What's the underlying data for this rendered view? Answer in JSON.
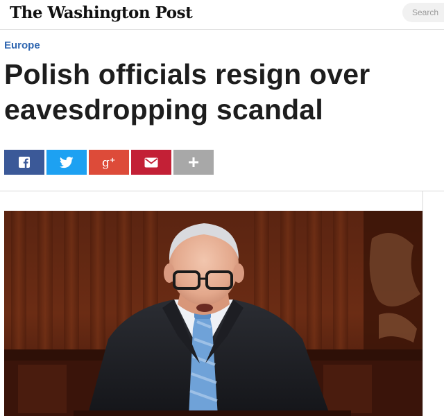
{
  "masthead": {
    "logo_text": "The Washington Post",
    "search_label": "Search"
  },
  "article": {
    "kicker": "Europe",
    "headline": "Polish officials resign over eavesdropping scandal"
  },
  "share": {
    "buttons": [
      {
        "name": "facebook",
        "icon": "facebook-icon",
        "color": "#3b5998"
      },
      {
        "name": "twitter",
        "icon": "twitter-icon",
        "color": "#1da1f2"
      },
      {
        "name": "google-plus",
        "icon": "google-plus-icon",
        "color": "#dd4b39"
      },
      {
        "name": "email",
        "icon": "email-icon",
        "color": "#c32036"
      },
      {
        "name": "more",
        "icon": "plus-icon",
        "color": "#a8a8a8"
      }
    ]
  },
  "colors": {
    "kicker": "#2f66b0",
    "headline": "#1d1d1d",
    "search_bg": "#f1f1f1"
  }
}
